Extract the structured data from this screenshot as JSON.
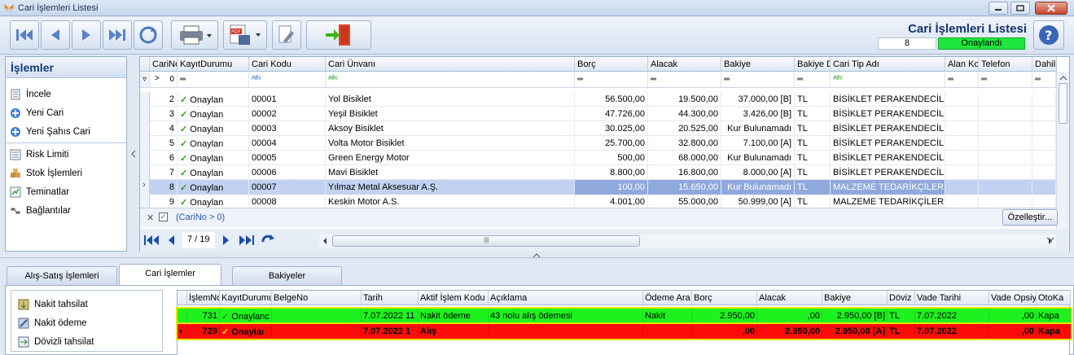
{
  "window": {
    "title": "Cari İşlemleri Listesi"
  },
  "toolbar": {
    "page_title": "Cari İşlemleri Listesi",
    "count": "8",
    "status": "Onaylandı"
  },
  "left_panel": {
    "header": "İşlemler",
    "items": [
      "İncele",
      "Yeni Cari",
      "Yeni Şahıs Cari",
      "Risk Limiti",
      "Stok İşlemleri",
      "Teminatlar",
      "Bağlantılar"
    ]
  },
  "grid": {
    "columns": [
      "CariNo",
      "KayıtDurumu",
      "Cari Kodu",
      "Cari Ünvanı",
      "Borç",
      "Alacak",
      "Bakiye",
      "Bakiye D",
      "Cari Tip Adı",
      "Alan Ko",
      "Telefon",
      "Dahili"
    ],
    "filter_row": {
      "carino": "0"
    },
    "rows": [
      {
        "no": "2",
        "durum": "Onaylan",
        "kod": "00001",
        "unvan": "Yol Bisiklet",
        "borc": "56.500,00",
        "alacak": "19.500,00",
        "bakiye": "37.000,00 [B]",
        "doviz": "TL",
        "tip": "BİSİKLET PERAKENDECİLERİ"
      },
      {
        "no": "3",
        "durum": "Onaylan",
        "kod": "00002",
        "unvan": "Yeşil Bisiklet",
        "borc": "47.726,00",
        "alacak": "44.300,00",
        "bakiye": "3.426,00 [B]",
        "doviz": "TL",
        "tip": "BİSİKLET PERAKENDECİLERİ"
      },
      {
        "no": "4",
        "durum": "Onaylan",
        "kod": "00003",
        "unvan": "Aksoy Bisiklet",
        "borc": "30.025,00",
        "alacak": "20.525,00",
        "bakiye": "Kur Bulunamadı",
        "doviz": "TL",
        "tip": "BİSİKLET PERAKENDECİLERİ"
      },
      {
        "no": "5",
        "durum": "Onaylan",
        "kod": "00004",
        "unvan": "Volta Motor Bisiklet",
        "borc": "25.700,00",
        "alacak": "32.800,00",
        "bakiye": "7.100,00 [A]",
        "doviz": "TL",
        "tip": "BİSİKLET PERAKENDECİLERİ"
      },
      {
        "no": "6",
        "durum": "Onaylan",
        "kod": "00005",
        "unvan": "Green Energy Motor",
        "borc": "500,00",
        "alacak": "68.000,00",
        "bakiye": "Kur Bulunamadı",
        "doviz": "TL",
        "tip": "BİSİKLET PERAKENDECİLERİ"
      },
      {
        "no": "7",
        "durum": "Onaylan",
        "kod": "00006",
        "unvan": "Mavi Bisiklet",
        "borc": "8.800,00",
        "alacak": "16.800,00",
        "bakiye": "8.000,00 [A]",
        "doviz": "TL",
        "tip": "BİSİKLET PERAKENDECİLERİ"
      },
      {
        "no": "8",
        "durum": "Onaylan",
        "kod": "00007",
        "unvan": "Yılmaz Metal Aksesuar A.Ş.",
        "borc": "100,00",
        "alacak": "15.650,00",
        "bakiye": "Kur Bulunamadı",
        "doviz": "TL",
        "tip": "MALZEME TEDARİKÇİLERİ"
      },
      {
        "no": "9",
        "durum": "Onaylan",
        "kod": "00008",
        "unvan": "Keskin Motor A.S.",
        "borc": "4.001,00",
        "alacak": "55.000,00",
        "bakiye": "50.999,00 [A]",
        "doviz": "TL",
        "tip": "MALZEME TEDARİKÇİLERİ"
      }
    ],
    "filter_text": "(CariNo > 0)",
    "customize": "Özelleştir...",
    "pager": "7 / 19"
  },
  "tabs": [
    "Alış-Satış İşlemleri",
    "Cari İşlemler",
    "Bakiyeler"
  ],
  "bottom_left": [
    "Nakit tahsilat",
    "Nakit ödeme",
    "Dövizli tahsilat"
  ],
  "bottom_grid": {
    "columns": [
      "İşlemNo",
      "KayıtDurumu",
      "BelgeNo",
      "Tarih",
      "Aktif İşlem Kodu",
      "Açıklama",
      "Ödeme Ara",
      "Borç",
      "Alacak",
      "Bakiye",
      "Döviz",
      "Vade Tarihi",
      "Vade Opsiy",
      "OtoKa"
    ],
    "rows": [
      {
        "no": "731",
        "durum": "Onaylanc",
        "belge": "",
        "tarih": "7.07.2022 11",
        "kod": "Nakit ödeme",
        "aciklama": "43 nolu alış ödemesi",
        "odeme": "Nakit",
        "borc": "2.950,00",
        "alacak": ",00",
        "bakiye": "2.950,00 [B]",
        "doviz": "TL",
        "vade": "7.07.2022",
        "opsiy": ",00",
        "oto": "Kapa"
      },
      {
        "no": "729",
        "durum": "Onaylaı",
        "belge": "",
        "tarih": "7.07.2022 1",
        "kod": "Alış",
        "aciklama": "",
        "odeme": "",
        "borc": ",00",
        "alacak": "2.950,00",
        "bakiye": "2.950,00 [A]",
        "doviz": "TL",
        "vade": "7.07.2022",
        "opsiy": ",00",
        "oto": "Kapa"
      }
    ]
  },
  "colors": {
    "green_row": "#1ef21e",
    "red_row": "#ff0a0a",
    "status_green": "#1ee63c",
    "selected_row": "#8fa9dc"
  }
}
